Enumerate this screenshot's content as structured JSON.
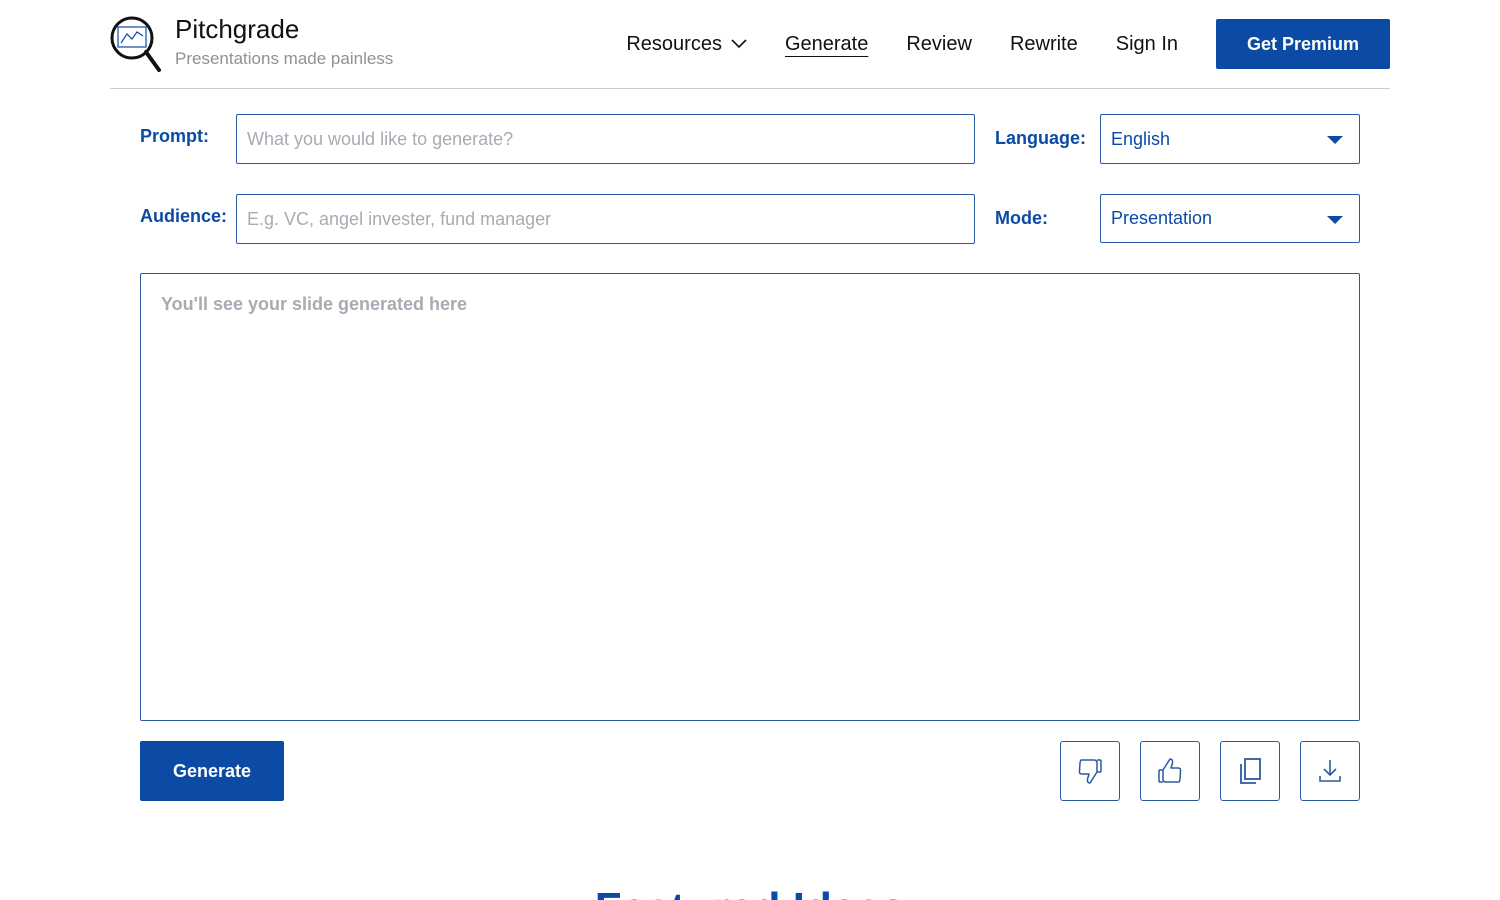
{
  "brand": {
    "name": "Pitchgrade",
    "tagline": "Presentations made painless",
    "logo_icon": "magnifier-chart-icon"
  },
  "nav": {
    "resources": "Resources",
    "generate": "Generate",
    "review": "Review",
    "rewrite": "Rewrite",
    "sign_in": "Sign In",
    "premium": "Get Premium"
  },
  "form": {
    "prompt_label": "Prompt:",
    "prompt_placeholder": "What you would like to generate?",
    "prompt_value": "",
    "audience_label": "Audience:",
    "audience_placeholder": "E.g. VC, angel invester, fund manager",
    "audience_value": "",
    "language_label": "Language:",
    "language_value": "English",
    "mode_label": "Mode:",
    "mode_value": "Presentation"
  },
  "output": {
    "placeholder": "You'll see your slide generated here"
  },
  "actions": {
    "generate_label": "Generate",
    "icons": [
      "thumbs-down-icon",
      "thumbs-up-icon",
      "copy-icon",
      "download-icon"
    ]
  },
  "next_section": {
    "heading": "Featured Ideas"
  },
  "colors": {
    "primary": "#0b4aa5",
    "border": "#2c5aa0",
    "placeholder": "#a7abb3",
    "tagline": "#8f9196"
  }
}
